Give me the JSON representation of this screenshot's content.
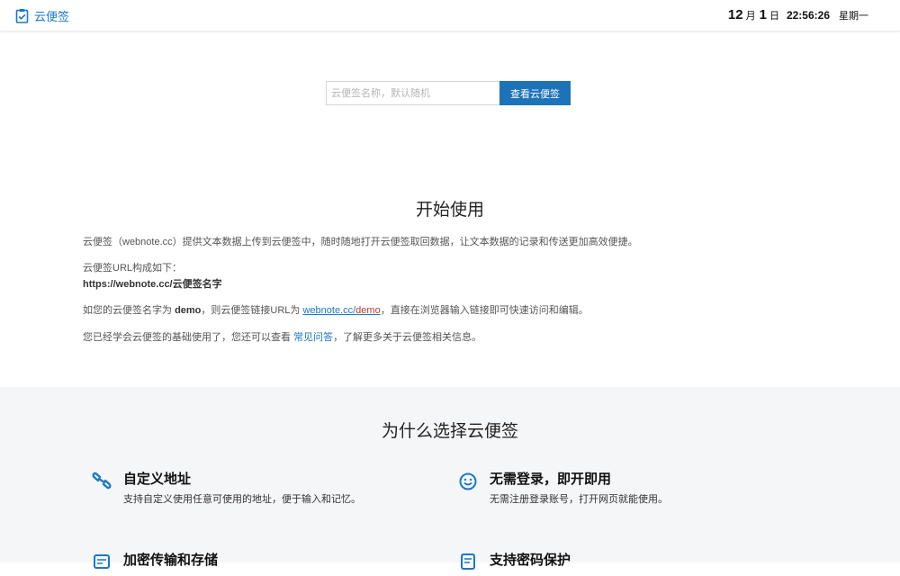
{
  "header": {
    "brand": "云便签",
    "clock": {
      "month": "12",
      "month_unit": "月",
      "day": "1",
      "day_unit": "日",
      "time": "22:56:26",
      "weekday": "星期一"
    }
  },
  "search": {
    "placeholder": "云便签名称，默认随机",
    "value": "",
    "button": "查看云便签"
  },
  "intro": {
    "title": "开始使用",
    "p1": "云便签（webnote.cc）提供文本数据上传到云便签中，随时随地打开云便签取回数据，让文本数据的记录和传送更加高效便捷。",
    "p2_line1": "云便签URL构成如下：",
    "p2_line2": "https://webnote.cc/云便签名字",
    "p3_pre": "如您的云便签名字为 ",
    "p3_demo": "demo",
    "p3_mid": "，则云便签链接URL为 ",
    "p3_link_host": "webnote.cc/",
    "p3_link_path": "demo",
    "p3_post": "，直接在浏览器输入链接即可快速访问和编辑。",
    "p4_pre": "您已经学会云便签的基础使用了，您还可以查看 ",
    "p4_link": "常见问答",
    "p4_post": "，了解更多关于云便签相关信息。"
  },
  "features": {
    "title": "为什么选择云便签",
    "items": [
      {
        "icon": "link-icon",
        "title": "自定义地址",
        "desc": "支持自定义使用任意可使用的地址，便于输入和记忆。"
      },
      {
        "icon": "smile-icon",
        "title": "无需登录，即开即用",
        "desc": "无需注册登录账号，打开网页就能使用。"
      },
      {
        "icon": "cloud-sync-icon",
        "title": "加密传输和存储",
        "desc": ""
      },
      {
        "icon": "lock-note-icon",
        "title": "支持密码保护",
        "desc": ""
      }
    ]
  },
  "colors": {
    "accent": "#1a79c4",
    "button": "#1d73b7",
    "features_bg": "#f5f6f8",
    "link_red": "#c0392b"
  }
}
